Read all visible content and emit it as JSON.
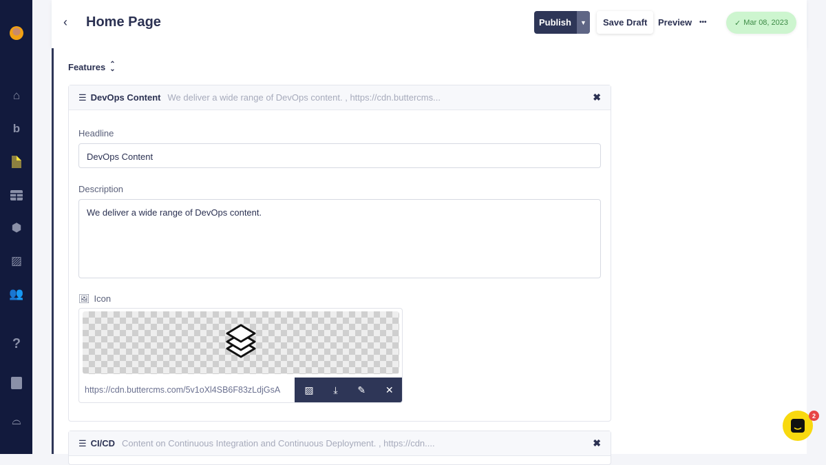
{
  "sidebar": {
    "items": [
      "avatar",
      "home-icon",
      "blog-icon",
      "pages-icon",
      "collections-icon",
      "components-icon",
      "media-icon",
      "users-icon",
      "help-icon",
      "docs-icon",
      "integrations-icon"
    ]
  },
  "header": {
    "back": "‹",
    "title": "Home Page",
    "publish": "Publish",
    "save_draft": "Save Draft",
    "preview": "Preview",
    "more": "•••",
    "date": "Mar 08, 2023"
  },
  "features": {
    "label": "Features",
    "sort": "⌃⌄"
  },
  "items": [
    {
      "title": "DevOps Content",
      "summary": "We deliver a wide range of DevOps content. , https://cdn.buttercms...",
      "headline_label": "Headline",
      "headline": "DevOps Content",
      "description_label": "Description",
      "description": "We deliver a wide range of DevOps content.",
      "icon_label": "Icon",
      "icon_url": "https://cdn.buttercms.com/5v1oXl4SB6F83zLdjGsA"
    },
    {
      "title": "CI/CD",
      "summary": "Content on Continuous Integration and Continuous Deployment. , https://cdn...."
    }
  ],
  "chat": {
    "badge": "2"
  },
  "colors": {
    "sidebar": "#121a3d",
    "primary": "#2e3657",
    "date_badge": "#cdf5cf",
    "chat": "#f8d90f"
  }
}
